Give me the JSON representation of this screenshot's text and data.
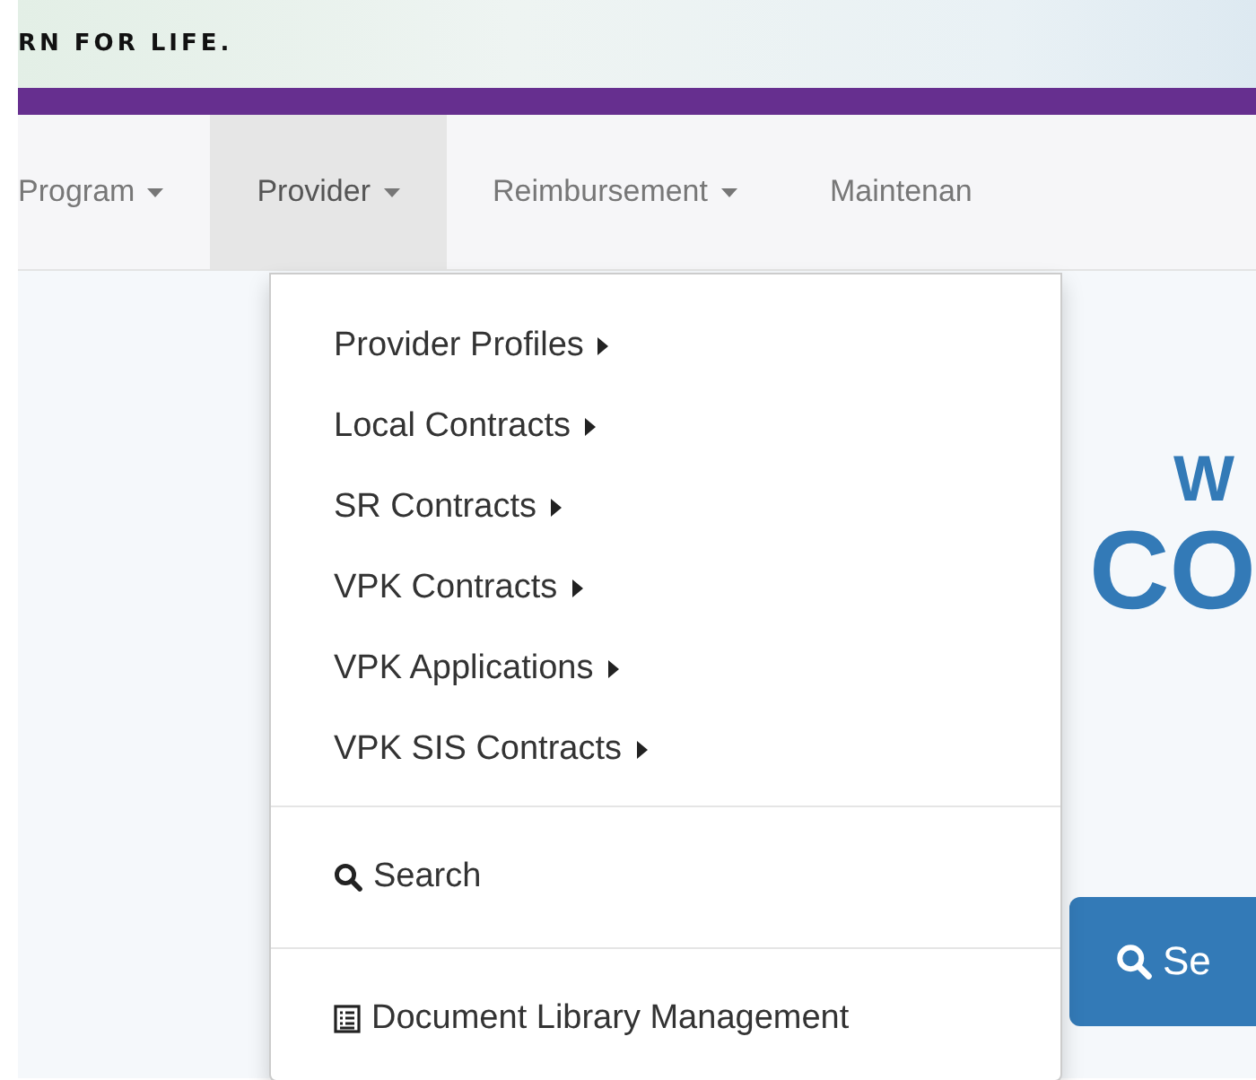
{
  "banner": {
    "tagline": "RN FOR LIFE."
  },
  "nav": [
    {
      "label": "Program",
      "selected": false
    },
    {
      "label": "Provider",
      "selected": true
    },
    {
      "label": "Reimbursement",
      "selected": false
    },
    {
      "label": "Maintenan",
      "selected": false
    }
  ],
  "dropdown": {
    "sections": [
      [
        {
          "kind": "submenu",
          "label": "Provider Profiles"
        },
        {
          "kind": "submenu",
          "label": "Local Contracts"
        },
        {
          "kind": "submenu",
          "label": "SR Contracts"
        },
        {
          "kind": "submenu",
          "label": "VPK Contracts"
        },
        {
          "kind": "submenu",
          "label": "VPK Applications"
        },
        {
          "kind": "submenu",
          "label": "VPK SIS Contracts"
        }
      ],
      [
        {
          "kind": "search",
          "label": "Search"
        }
      ],
      [
        {
          "kind": "document",
          "label": "Document Library Management"
        }
      ]
    ]
  },
  "hero": {
    "line_1": "W",
    "line_2": "CO",
    "button": "Se"
  }
}
